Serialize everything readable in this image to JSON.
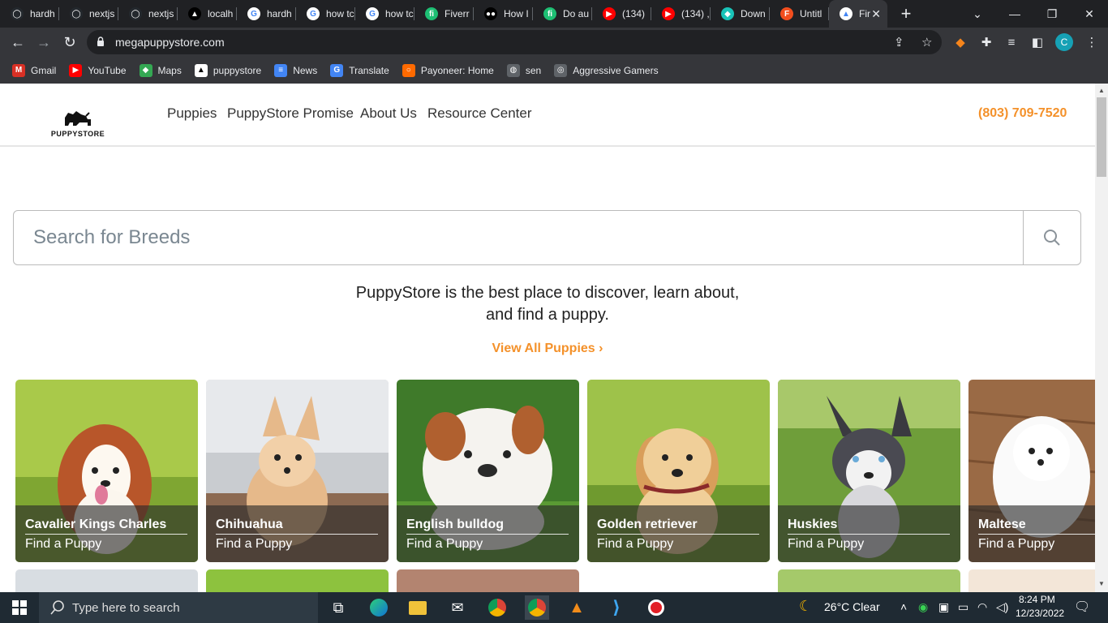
{
  "browser": {
    "tabs": [
      {
        "label": "hardh",
        "icon": "github-icon"
      },
      {
        "label": "nextjs",
        "icon": "github-icon"
      },
      {
        "label": "nextjs",
        "icon": "github-icon"
      },
      {
        "label": "localh",
        "icon": "triangle-icon"
      },
      {
        "label": "hardh",
        "icon": "google-icon"
      },
      {
        "label": "how tc",
        "icon": "google-icon"
      },
      {
        "label": "how tc",
        "icon": "google-icon"
      },
      {
        "label": "Fiverr",
        "icon": "fiverr-icon"
      },
      {
        "label": "How I",
        "icon": "medium-icon"
      },
      {
        "label": "Do au",
        "icon": "fiverr-icon"
      },
      {
        "label": "(134)",
        "icon": "youtube-icon"
      },
      {
        "label": "(134) ,",
        "icon": "youtube-icon"
      },
      {
        "label": "Down",
        "icon": "diamond-icon"
      },
      {
        "label": "Untitl",
        "icon": "figma-icon"
      },
      {
        "label": "Fir",
        "icon": "puppystore-icon"
      }
    ],
    "url": "megapuppystore.com",
    "bookmarks": [
      {
        "label": "Gmail",
        "icon": "gmail-icon"
      },
      {
        "label": "YouTube",
        "icon": "youtube-icon"
      },
      {
        "label": "Maps",
        "icon": "maps-icon"
      },
      {
        "label": "puppystore",
        "icon": "puppystore-icon"
      },
      {
        "label": "News",
        "icon": "news-icon"
      },
      {
        "label": "Translate",
        "icon": "translate-icon"
      },
      {
        "label": "Payoneer: Home",
        "icon": "payoneer-icon"
      },
      {
        "label": "sen",
        "icon": "globe-icon"
      },
      {
        "label": "Aggressive Gamers",
        "icon": "gamers-icon"
      }
    ],
    "profile_initial": "C"
  },
  "site": {
    "logo_text": "PUPPYSTORE",
    "nav": [
      "Puppies",
      "PuppyStore Promise",
      "About Us",
      "Resource Center"
    ],
    "phone": "(803) 709-7520",
    "search_placeholder": "Search for Breeds",
    "tagline_line1": "PuppyStore is the best place to discover, learn about,",
    "tagline_line2": "and find a puppy.",
    "view_all": "View All Puppies ›",
    "cards": [
      {
        "breed": "Cavalier Kings Charles",
        "cta": "Find a Puppy"
      },
      {
        "breed": "Chihuahua",
        "cta": "Find a Puppy"
      },
      {
        "breed": "English bulldog",
        "cta": "Find a Puppy"
      },
      {
        "breed": "Golden retriever",
        "cta": "Find a Puppy"
      },
      {
        "breed": "Huskies",
        "cta": "Find a Puppy"
      },
      {
        "breed": "Maltese",
        "cta": "Find a Puppy"
      }
    ]
  },
  "taskbar": {
    "search_placeholder": "Type here to search",
    "weather": "26°C  Clear",
    "time": "8:24 PM",
    "date": "12/23/2022"
  },
  "colors": {
    "accent": "#f4912a",
    "chrome_dark": "#202124",
    "chrome_mid": "#35363a"
  }
}
